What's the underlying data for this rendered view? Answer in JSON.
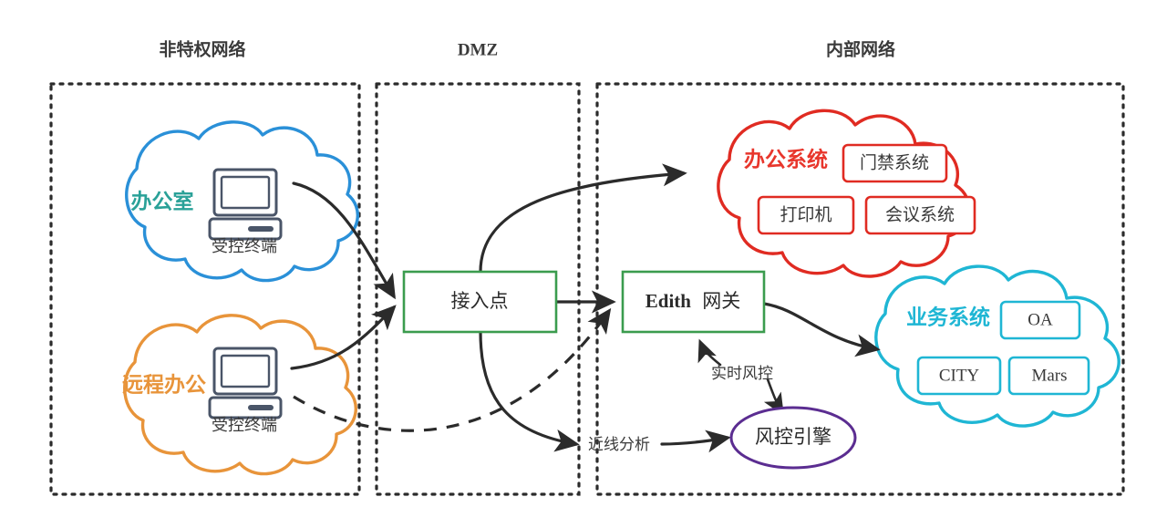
{
  "zones": [
    {
      "id": "untrusted",
      "label": "非特权网络"
    },
    {
      "id": "dmz",
      "label": "DMZ"
    },
    {
      "id": "internal",
      "label": "内部网络"
    }
  ],
  "clouds": [
    {
      "id": "office",
      "label": "办公室",
      "label_color": "#2aa198",
      "stroke": "#2a90d8",
      "terminal_label": "受控终端",
      "icon": "desktop-computer-icon"
    },
    {
      "id": "remote-office",
      "label": "远程办公",
      "label_color": "#e8943a",
      "stroke": "#e8943a",
      "terminal_label": "受控终端",
      "icon": "desktop-computer-icon"
    },
    {
      "id": "office-system",
      "label": "办公系统",
      "label_color": "#e8362c",
      "stroke": "#e02b22",
      "items": [
        "门禁系统",
        "打印机",
        "会议系统"
      ]
    },
    {
      "id": "business-system",
      "label": "业务系统",
      "label_color": "#1fb6d4",
      "stroke": "#1fb6d4",
      "items": [
        "OA",
        "CITY",
        "Mars"
      ]
    }
  ],
  "nodes": [
    {
      "id": "access-point",
      "label": "接入点",
      "stroke": "#3b9c4e"
    },
    {
      "id": "edith-gateway",
      "label_bold": "Edith",
      "label": "网关",
      "stroke": "#3b9c4e"
    },
    {
      "id": "risk-engine",
      "label": "风控引擎",
      "stroke": "#5b2d91"
    }
  ],
  "edge_labels": [
    {
      "id": "realtime-risk",
      "label": "实时风控"
    },
    {
      "id": "nearline-analysis",
      "label": "近线分析"
    }
  ],
  "colors": {
    "blue": "#2a90d8",
    "orange": "#e8943a",
    "teal": "#2aa198",
    "red": "#e02b22",
    "cyan": "#1fb6d4",
    "green": "#3b9c4e",
    "purple": "#5b2d91",
    "ink": "#2b2b2b",
    "background": "#ffffff"
  }
}
